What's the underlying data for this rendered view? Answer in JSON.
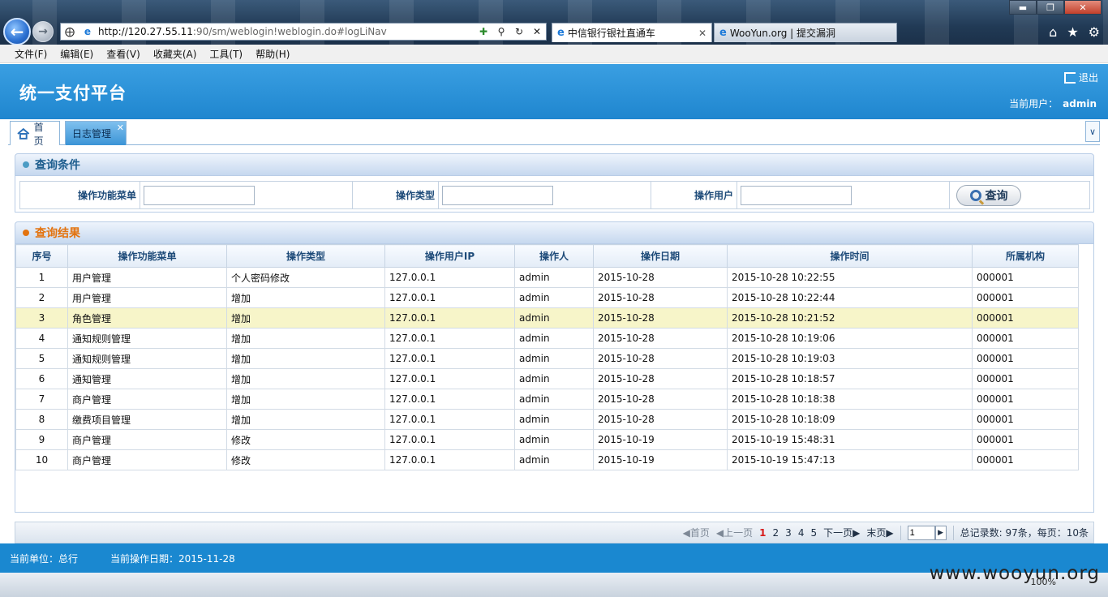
{
  "browser": {
    "url_host": "http://120.27.55.11",
    "url_path": ":90/sm/weblogin!weblogin.do#logLiNav",
    "tabs": [
      {
        "label": "中信银行银社直通车"
      },
      {
        "label": "WooYun.org | 提交漏洞"
      }
    ],
    "menu": [
      "文件(F)",
      "编辑(E)",
      "查看(V)",
      "收藏夹(A)",
      "工具(T)",
      "帮助(H)"
    ],
    "zoom": "100%"
  },
  "header": {
    "title": "统一支付平台",
    "logout_label": "退出",
    "current_user_label": "当前用户：",
    "current_user": "admin"
  },
  "tabs": {
    "home": "首页",
    "log": "日志管理"
  },
  "query": {
    "title": "查询条件",
    "menu_label": "操作功能菜单",
    "type_label": "操作类型",
    "user_label": "操作用户",
    "button": "查询",
    "menu_value": "",
    "type_value": "",
    "user_value": ""
  },
  "results": {
    "title": "查询结果",
    "columns": [
      "序号",
      "操作功能菜单",
      "操作类型",
      "操作用户IP",
      "操作人",
      "操作日期",
      "操作时间",
      "所属机构"
    ],
    "rows": [
      [
        "1",
        "用户管理",
        "个人密码修改",
        "127.0.0.1",
        "admin",
        "2015-10-28",
        "2015-10-28 10:22:55",
        "000001"
      ],
      [
        "2",
        "用户管理",
        "增加",
        "127.0.0.1",
        "admin",
        "2015-10-28",
        "2015-10-28 10:22:44",
        "000001"
      ],
      [
        "3",
        "角色管理",
        "增加",
        "127.0.0.1",
        "admin",
        "2015-10-28",
        "2015-10-28 10:21:52",
        "000001"
      ],
      [
        "4",
        "通知规则管理",
        "增加",
        "127.0.0.1",
        "admin",
        "2015-10-28",
        "2015-10-28 10:19:06",
        "000001"
      ],
      [
        "5",
        "通知规则管理",
        "增加",
        "127.0.0.1",
        "admin",
        "2015-10-28",
        "2015-10-28 10:19:03",
        "000001"
      ],
      [
        "6",
        "通知管理",
        "增加",
        "127.0.0.1",
        "admin",
        "2015-10-28",
        "2015-10-28 10:18:57",
        "000001"
      ],
      [
        "7",
        "商户管理",
        "增加",
        "127.0.0.1",
        "admin",
        "2015-10-28",
        "2015-10-28 10:18:38",
        "000001"
      ],
      [
        "8",
        "缴费项目管理",
        "增加",
        "127.0.0.1",
        "admin",
        "2015-10-28",
        "2015-10-28 10:18:09",
        "000001"
      ],
      [
        "9",
        "商户管理",
        "修改",
        "127.0.0.1",
        "admin",
        "2015-10-19",
        "2015-10-19 15:48:31",
        "000001"
      ],
      [
        "10",
        "商户管理",
        "修改",
        "127.0.0.1",
        "admin",
        "2015-10-19",
        "2015-10-19 15:47:13",
        "000001"
      ]
    ]
  },
  "pager": {
    "first": "首页",
    "prev": "上一页",
    "pages": [
      "1",
      "2",
      "3",
      "4",
      "5"
    ],
    "next": "下一页",
    "last": "末页",
    "page_value": "1",
    "summary": "总记录数: 97条，每页：10条"
  },
  "footer": {
    "unit": "当前单位：总行",
    "date": "当前操作日期：2015-11-28"
  },
  "watermark": "www.wooyun.org",
  "colors": {
    "header_blue": "#1f86cf",
    "highlight_row": "#f7f5c9",
    "result_title": "#e3730f"
  }
}
